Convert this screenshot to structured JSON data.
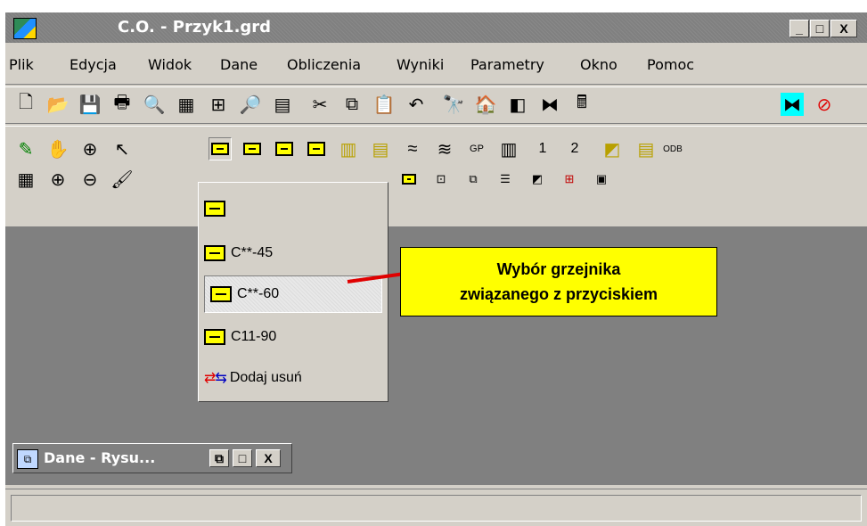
{
  "window": {
    "title": "C.O. - Przyk1.grd"
  },
  "caption_buttons": {
    "minimize": "_",
    "maximize": "□",
    "close": "X"
  },
  "menu": [
    "Plik",
    "Edycja",
    "Widok",
    "Dane",
    "Obliczenia",
    "Wyniki",
    "Parametry",
    "Okno",
    "Pomoc"
  ],
  "toolbar2_labels": {
    "one": "1",
    "two": "2",
    "gp": "GP",
    "odb": "ODB"
  },
  "dropdown": {
    "items": [
      {
        "label": "",
        "icon": "radiator-icon"
      },
      {
        "label": "C**-45",
        "icon": "radiator-icon"
      },
      {
        "label": "C**-60",
        "icon": "radiator-icon",
        "selected": true
      },
      {
        "label": "C11-90",
        "icon": "radiator-icon"
      },
      {
        "label": "Dodaj usuń",
        "icon": "add-remove-icon"
      }
    ]
  },
  "callout": {
    "line1": "Wybór  grzejnika",
    "line2": "związanego  z  przyciskiem"
  },
  "mdi_child": {
    "title": "Dane - Rysu..."
  },
  "colors": {
    "accent": "#ffff00",
    "callout_line": "#e00000"
  }
}
